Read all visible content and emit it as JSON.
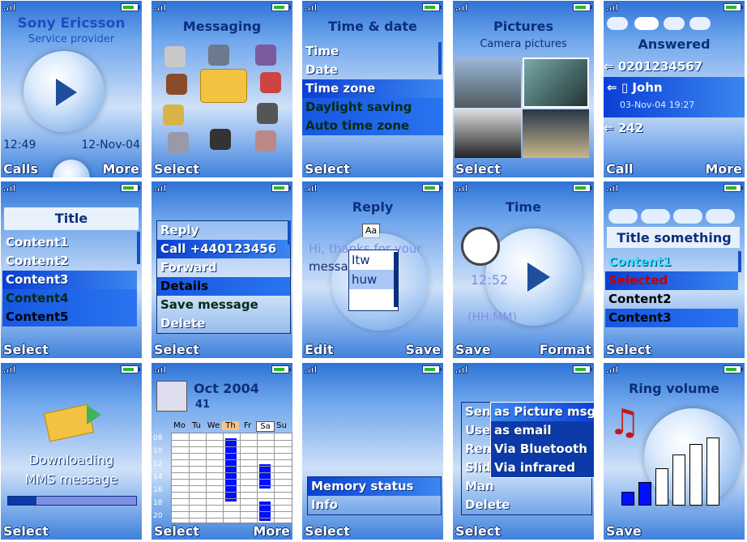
{
  "s1": {
    "brand": "Sony Ericsson",
    "provider": "Service provider",
    "time": "12:49",
    "date": "12-Nov-04",
    "left": "Calls",
    "right": "More"
  },
  "s2": {
    "title": "Messaging",
    "left": "Select"
  },
  "s3": {
    "title": "Time & date",
    "items": [
      "Time",
      "Date",
      "Time zone",
      "Daylight saving",
      "Auto time zone"
    ],
    "left": "Select"
  },
  "s4": {
    "title": "Pictures",
    "sub": "Camera pictures",
    "left": "Select"
  },
  "s5": {
    "title": "Answered",
    "num1": "0201234567",
    "name": "John",
    "stamp": "03-Nov-04 19:27",
    "num2": "242",
    "left": "Call",
    "right": "More"
  },
  "s6": {
    "title": "Title",
    "items": [
      "Content1",
      "Content2",
      "Content3",
      "Content4",
      "Content5"
    ],
    "left": "Select"
  },
  "s7": {
    "items": [
      "Reply",
      "Call +440123456",
      "Forward",
      "Details",
      "Save message",
      "Delete"
    ],
    "left": "Select"
  },
  "s8": {
    "title": "Reply",
    "badge": "Aa",
    "text1": "Hi, thanks for your",
    "text2": "messa",
    "opt1": "Itw",
    "opt2": "huw",
    "left": "Edit",
    "right": "Save"
  },
  "s9": {
    "title": "Time",
    "time": "12:52",
    "fmt": "(HH:MM)",
    "left": "Save",
    "right": "Format"
  },
  "s10": {
    "title": "Title something",
    "items": [
      "Content1",
      "Selected",
      "Content2",
      "Content3"
    ],
    "left": "Select"
  },
  "s11": {
    "line1": "Downloading",
    "line2": "MMS message",
    "progress": 0.22,
    "left": "Select"
  },
  "s12": {
    "month": "Oct 2004",
    "week": "41",
    "days": [
      "Mo",
      "Tu",
      "We",
      "Th",
      "Fr",
      "Sa",
      "Su"
    ],
    "hours": [
      "08",
      "10",
      "12",
      "14",
      "16",
      "18",
      "20"
    ],
    "left": "Select",
    "right": "More"
  },
  "s13": {
    "items": [
      "Memory status",
      "Info"
    ],
    "left": "Select"
  },
  "s14": {
    "back": [
      "Send",
      "Use",
      "Rem",
      "Slid",
      "Man",
      "Delete"
    ],
    "opts": [
      "as Picture msg",
      "as email",
      "Via Bluetooth",
      "Via infrared"
    ],
    "left": "Select"
  },
  "s15": {
    "title": "Ring volume",
    "left": "Save",
    "levels": [
      0.2,
      0.35,
      0.55,
      0.75,
      0.9,
      1.0
    ]
  },
  "colors": {
    "accent": "#2a74f0",
    "selection": "#0a3fd6",
    "title": "#0c2f7a"
  }
}
